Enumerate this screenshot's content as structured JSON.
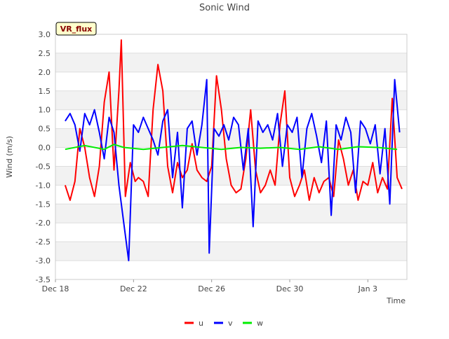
{
  "chart_data": {
    "type": "line",
    "title": "Sonic Wind",
    "badge": "VR_flux",
    "xlabel": "Time",
    "ylabel": "Wind (m/s)",
    "ylim": [
      -3.5,
      3.0
    ],
    "yticks": [
      3.0,
      2.5,
      2.0,
      1.5,
      1.0,
      0.5,
      0.0,
      -0.5,
      -1.0,
      -1.5,
      -2.0,
      -2.5,
      -3.0,
      -3.5
    ],
    "xlim": [
      "2023-12-18",
      "2024-01-05"
    ],
    "xticks": [
      {
        "date": "2023-12-18",
        "label": "Dec 18"
      },
      {
        "date": "2023-12-22",
        "label": "Dec 22"
      },
      {
        "date": "2023-12-26",
        "label": "Dec 26"
      },
      {
        "date": "2023-12-30",
        "label": "Dec 30"
      },
      {
        "date": "2024-01-03",
        "label": "Jan 3"
      }
    ],
    "grid": "horizontal bands",
    "legend_position": "bottom",
    "series": [
      {
        "name": "u",
        "color": "#ff0000",
        "points": [
          [
            "2023-12-18T12:00",
            -1.0
          ],
          [
            "2023-12-18T18:00",
            -1.4
          ],
          [
            "2023-12-19T00:00",
            -0.9
          ],
          [
            "2023-12-19T06:00",
            0.5
          ],
          [
            "2023-12-19T12:00",
            0.0
          ],
          [
            "2023-12-19T18:00",
            -0.8
          ],
          [
            "2023-12-20T00:00",
            -1.3
          ],
          [
            "2023-12-20T06:00",
            -0.5
          ],
          [
            "2023-12-20T12:00",
            1.2
          ],
          [
            "2023-12-20T18:00",
            2.0
          ],
          [
            "2023-12-21T00:00",
            -0.6
          ],
          [
            "2023-12-21T06:00",
            1.5
          ],
          [
            "2023-12-21T09:00",
            2.85
          ],
          [
            "2023-12-21T14:00",
            -1.3
          ],
          [
            "2023-12-21T20:00",
            -0.4
          ],
          [
            "2023-12-22T02:00",
            -0.9
          ],
          [
            "2023-12-22T06:00",
            -0.8
          ],
          [
            "2023-12-22T12:00",
            -0.9
          ],
          [
            "2023-12-22T18:00",
            -1.3
          ],
          [
            "2023-12-23T00:00",
            1.0
          ],
          [
            "2023-12-23T06:00",
            2.2
          ],
          [
            "2023-12-23T12:00",
            1.5
          ],
          [
            "2023-12-23T18:00",
            -0.5
          ],
          [
            "2023-12-24T00:00",
            -1.2
          ],
          [
            "2023-12-24T06:00",
            -0.4
          ],
          [
            "2023-12-24T12:00",
            -0.8
          ],
          [
            "2023-12-24T18:00",
            -0.6
          ],
          [
            "2023-12-25T00:00",
            0.1
          ],
          [
            "2023-12-25T06:00",
            -0.6
          ],
          [
            "2023-12-25T12:00",
            -0.8
          ],
          [
            "2023-12-25T18:00",
            -0.9
          ],
          [
            "2023-12-26T00:00",
            -0.5
          ],
          [
            "2023-12-26T06:00",
            1.9
          ],
          [
            "2023-12-26T12:00",
            1.0
          ],
          [
            "2023-12-26T18:00",
            -0.3
          ],
          [
            "2023-12-27T00:00",
            -1.0
          ],
          [
            "2023-12-27T06:00",
            -1.2
          ],
          [
            "2023-12-27T12:00",
            -1.1
          ],
          [
            "2023-12-27T18:00",
            -0.3
          ],
          [
            "2023-12-28T00:00",
            1.0
          ],
          [
            "2023-12-28T06:00",
            -0.6
          ],
          [
            "2023-12-28T12:00",
            -1.2
          ],
          [
            "2023-12-28T18:00",
            -1.0
          ],
          [
            "2023-12-29T00:00",
            -0.6
          ],
          [
            "2023-12-29T06:00",
            -1.0
          ],
          [
            "2023-12-29T12:00",
            0.6
          ],
          [
            "2023-12-29T18:00",
            1.5
          ],
          [
            "2023-12-30T00:00",
            -0.8
          ],
          [
            "2023-12-30T06:00",
            -1.3
          ],
          [
            "2023-12-30T12:00",
            -1.0
          ],
          [
            "2023-12-30T18:00",
            -0.6
          ],
          [
            "2023-12-31T00:00",
            -1.4
          ],
          [
            "2023-12-31T06:00",
            -0.8
          ],
          [
            "2023-12-31T12:00",
            -1.2
          ],
          [
            "2023-12-31T18:00",
            -0.9
          ],
          [
            "2024-01-01T00:00",
            -0.8
          ],
          [
            "2024-01-01T06:00",
            -1.3
          ],
          [
            "2024-01-01T12:00",
            0.2
          ],
          [
            "2024-01-01T18:00",
            -0.3
          ],
          [
            "2024-01-02T00:00",
            -1.0
          ],
          [
            "2024-01-02T06:00",
            -0.6
          ],
          [
            "2024-01-02T12:00",
            -1.4
          ],
          [
            "2024-01-02T18:00",
            -0.9
          ],
          [
            "2024-01-03T00:00",
            -1.0
          ],
          [
            "2024-01-03T06:00",
            -0.4
          ],
          [
            "2024-01-03T12:00",
            -1.2
          ],
          [
            "2024-01-03T18:00",
            -0.8
          ],
          [
            "2024-01-04T00:00",
            -1.1
          ],
          [
            "2024-01-04T06:00",
            1.3
          ],
          [
            "2024-01-04T12:00",
            -0.8
          ],
          [
            "2024-01-04T18:00",
            -1.1
          ]
        ]
      },
      {
        "name": "v",
        "color": "#0000ff",
        "points": [
          [
            "2023-12-18T12:00",
            0.7
          ],
          [
            "2023-12-18T18:00",
            0.9
          ],
          [
            "2023-12-19T00:00",
            0.6
          ],
          [
            "2023-12-19T06:00",
            -0.1
          ],
          [
            "2023-12-19T12:00",
            0.9
          ],
          [
            "2023-12-19T18:00",
            0.6
          ],
          [
            "2023-12-20T00:00",
            1.0
          ],
          [
            "2023-12-20T06:00",
            0.4
          ],
          [
            "2023-12-20T12:00",
            -0.3
          ],
          [
            "2023-12-20T18:00",
            0.8
          ],
          [
            "2023-12-21T00:00",
            0.4
          ],
          [
            "2023-12-21T06:00",
            -1.0
          ],
          [
            "2023-12-21T12:00",
            -2.0
          ],
          [
            "2023-12-21T18:00",
            -3.0
          ],
          [
            "2023-12-22T00:00",
            0.6
          ],
          [
            "2023-12-22T06:00",
            0.4
          ],
          [
            "2023-12-22T12:00",
            0.8
          ],
          [
            "2023-12-22T18:00",
            0.5
          ],
          [
            "2023-12-23T00:00",
            0.2
          ],
          [
            "2023-12-23T06:00",
            -0.2
          ],
          [
            "2023-12-23T12:00",
            0.7
          ],
          [
            "2023-12-23T18:00",
            1.0
          ],
          [
            "2023-12-24T00:00",
            -0.8
          ],
          [
            "2023-12-24T06:00",
            0.4
          ],
          [
            "2023-12-24T12:00",
            -1.6
          ],
          [
            "2023-12-24T18:00",
            0.5
          ],
          [
            "2023-12-25T00:00",
            0.7
          ],
          [
            "2023-12-25T06:00",
            -0.2
          ],
          [
            "2023-12-25T12:00",
            0.6
          ],
          [
            "2023-12-25T18:00",
            1.8
          ],
          [
            "2023-12-25T21:00",
            -2.8
          ],
          [
            "2023-12-26T03:00",
            0.5
          ],
          [
            "2023-12-26T09:00",
            0.3
          ],
          [
            "2023-12-26T15:00",
            0.6
          ],
          [
            "2023-12-26T21:00",
            0.2
          ],
          [
            "2023-12-27T03:00",
            0.8
          ],
          [
            "2023-12-27T09:00",
            0.6
          ],
          [
            "2023-12-27T15:00",
            -0.6
          ],
          [
            "2023-12-27T21:00",
            0.5
          ],
          [
            "2023-12-28T03:00",
            -2.1
          ],
          [
            "2023-12-28T09:00",
            0.7
          ],
          [
            "2023-12-28T15:00",
            0.4
          ],
          [
            "2023-12-28T21:00",
            0.6
          ],
          [
            "2023-12-29T03:00",
            0.2
          ],
          [
            "2023-12-29T09:00",
            0.9
          ],
          [
            "2023-12-29T15:00",
            -0.5
          ],
          [
            "2023-12-29T21:00",
            0.6
          ],
          [
            "2023-12-30T03:00",
            0.4
          ],
          [
            "2023-12-30T09:00",
            0.8
          ],
          [
            "2023-12-30T15:00",
            -0.8
          ],
          [
            "2023-12-30T21:00",
            0.5
          ],
          [
            "2023-12-31T03:00",
            0.9
          ],
          [
            "2023-12-31T09:00",
            0.3
          ],
          [
            "2023-12-31T15:00",
            -0.4
          ],
          [
            "2023-12-31T21:00",
            0.7
          ],
          [
            "2024-01-01T03:00",
            -1.8
          ],
          [
            "2024-01-01T09:00",
            0.6
          ],
          [
            "2024-01-01T15:00",
            0.2
          ],
          [
            "2024-01-01T21:00",
            0.8
          ],
          [
            "2024-01-02T03:00",
            0.4
          ],
          [
            "2024-01-02T09:00",
            -1.2
          ],
          [
            "2024-01-02T15:00",
            0.7
          ],
          [
            "2024-01-02T21:00",
            0.5
          ],
          [
            "2024-01-03T03:00",
            0.1
          ],
          [
            "2024-01-03T09:00",
            0.6
          ],
          [
            "2024-01-03T15:00",
            -0.7
          ],
          [
            "2024-01-03T21:00",
            0.5
          ],
          [
            "2024-01-04T03:00",
            -1.5
          ],
          [
            "2024-01-04T09:00",
            1.8
          ],
          [
            "2024-01-04T15:00",
            0.4
          ]
        ]
      },
      {
        "name": "w",
        "color": "#00ee00",
        "points": [
          [
            "2023-12-18T12:00",
            -0.05
          ],
          [
            "2023-12-19T12:00",
            0.05
          ],
          [
            "2023-12-20T12:00",
            -0.05
          ],
          [
            "2023-12-21T00:00",
            0.08
          ],
          [
            "2023-12-21T12:00",
            0.0
          ],
          [
            "2023-12-22T12:00",
            -0.05
          ],
          [
            "2023-12-23T12:00",
            0.0
          ],
          [
            "2023-12-24T12:00",
            0.05
          ],
          [
            "2023-12-25T12:00",
            0.0
          ],
          [
            "2023-12-26T12:00",
            -0.05
          ],
          [
            "2023-12-27T12:00",
            0.0
          ],
          [
            "2023-12-28T12:00",
            -0.02
          ],
          [
            "2023-12-29T12:00",
            0.0
          ],
          [
            "2023-12-30T12:00",
            -0.05
          ],
          [
            "2023-12-31T12:00",
            0.02
          ],
          [
            "2024-01-01T12:00",
            -0.05
          ],
          [
            "2024-01-02T12:00",
            0.02
          ],
          [
            "2024-01-03T12:00",
            0.0
          ],
          [
            "2024-01-04T12:00",
            -0.05
          ]
        ]
      }
    ]
  }
}
